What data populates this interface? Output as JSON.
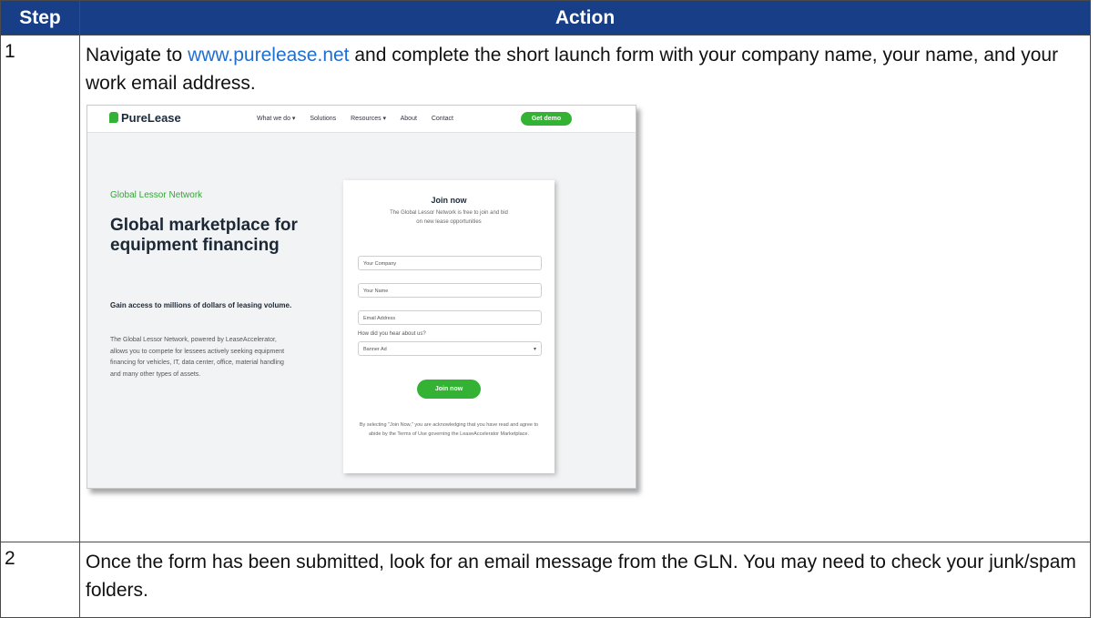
{
  "table": {
    "header_step": "Step",
    "header_action": "Action"
  },
  "steps": [
    {
      "number": "1",
      "text_before": "Navigate to ",
      "link_text": "www.purelease.net",
      "text_after": " and complete the short launch form with your company name, your name, and your work email address."
    },
    {
      "number": "2",
      "text": "Once the form has been submitted, look for an email message from the GLN. You may need to check your junk/spam folders."
    }
  ],
  "screenshot": {
    "logo": "PureLease",
    "nav": [
      "What we do ▾",
      "Solutions",
      "Resources ▾",
      "About",
      "Contact"
    ],
    "demo_button": "Get demo",
    "tagline": "Global Lessor Network",
    "hero_title": "Global marketplace for equipment financing",
    "gain_heading": "Gain access to millions of dollars of leasing volume.",
    "body": "The Global Lessor Network, powered by LeaseAccelerator, allows you to compete for lessees actively seeking equipment financing for vehicles, IT, data center, office, material handling and many other types of assets.",
    "form": {
      "title": "Join now",
      "subtitle": "The Global Lessor Network is free to join and bid on new lease opportunities",
      "company_placeholder": "Your Company",
      "name_placeholder": "Your Name",
      "email_placeholder": "Email Address",
      "select_label": "How did you hear about us?",
      "select_value": "Banner Ad",
      "submit": "Join now",
      "legal": "By selecting \"Join Now,\" you are acknowledging that you have read and agree to abide by the Terms of Use governing the LeaseAccelerator Marketplace."
    }
  },
  "colors": {
    "header_bg": "#173e86",
    "link": "#1f6fd1",
    "brand_green": "#34b233"
  }
}
